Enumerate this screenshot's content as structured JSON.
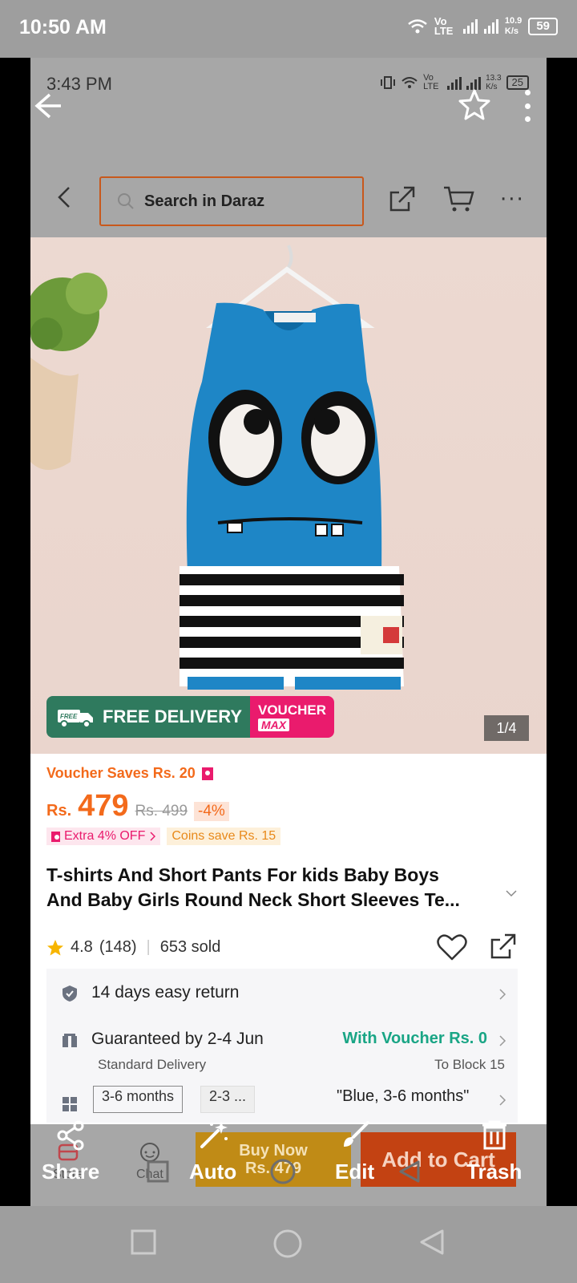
{
  "outer_status": {
    "time": "10:50 AM",
    "net_speed": "10.9",
    "net_unit": "K/s",
    "battery": "59",
    "volte": "Vo LTE"
  },
  "inner_status": {
    "time": "3:43 PM",
    "net_speed": "13.3",
    "net_unit": "K/s",
    "battery": "25",
    "volte": "Vo LTE"
  },
  "header": {
    "search_placeholder": "Search in Daraz"
  },
  "product": {
    "badge_free": "FREE DELIVERY",
    "badge_free_small": "FREE",
    "badge_voucher": "VOUCHER",
    "badge_max": "MAX",
    "image_counter": "1/4",
    "voucher_saves": "Voucher Saves Rs. 20",
    "currency": "Rs.",
    "price": "479",
    "old_price": "Rs. 499",
    "discount": "-4%",
    "extra_off": "Extra 4% OFF",
    "coins_save": "Coins save Rs. 15",
    "title_line1": "T-shirts And Short Pants For kids Baby Boys",
    "title_line2": "And Baby Girls Round Neck Short Sleeves Te...",
    "rating": "4.8",
    "reviews": "(148)",
    "sold": "653 sold"
  },
  "services": {
    "return": "14 days easy return",
    "guarantee": "Guaranteed by 2-4 Jun",
    "delivery_type": "Standard Delivery",
    "voucher_note": "With Voucher Rs. 0",
    "location": "To Block 15",
    "variant_1": "3-6 months",
    "variant_2": "2-3 ...",
    "variant_selected": "\"Blue, 3-6 months\""
  },
  "bottom_bar": {
    "store": "Store",
    "chat": "Chat",
    "buy_now_line1": "Buy Now",
    "buy_now_line2": "Rs. 479",
    "add_to_cart": "Add to Cart"
  },
  "edit_toolbar": {
    "share": "Share",
    "auto": "Auto",
    "edit": "Edit",
    "trash": "Trash"
  },
  "colors": {
    "accent": "#f36a1b",
    "teal": "#19a585",
    "pink": "#ea1b6d",
    "badge_green": "#2f7a5e"
  }
}
